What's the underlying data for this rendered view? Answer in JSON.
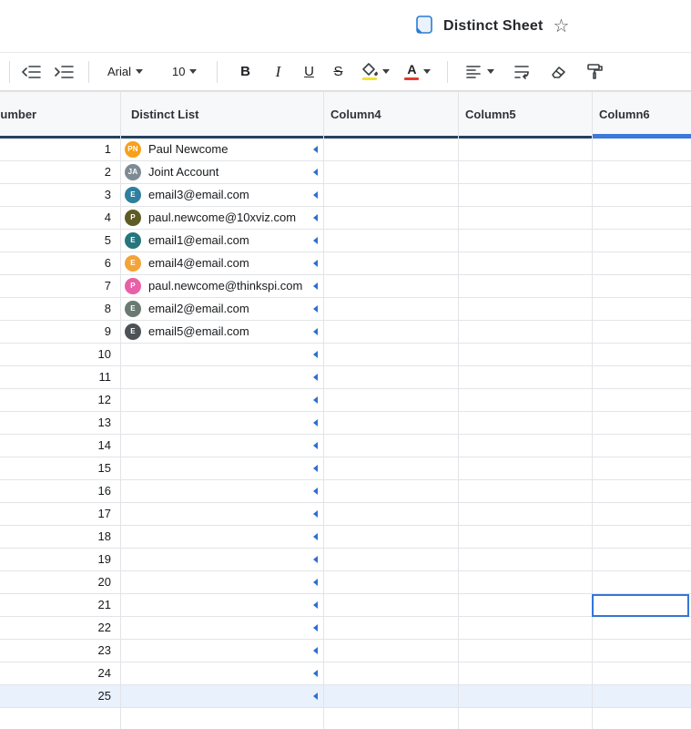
{
  "titlebar": {
    "title": "Distinct Sheet",
    "star": "☆"
  },
  "toolbar": {
    "font_name": "Arial",
    "font_size": "10",
    "bold": "B",
    "italic": "I",
    "underline": "U",
    "strikethrough": "S",
    "text_color_label": "A",
    "fill_swatch": "#f2e232",
    "text_swatch": "#e5392e"
  },
  "grid": {
    "columns": [
      {
        "label": "Number"
      },
      {
        "label": "Distinct List"
      },
      {
        "label": "Column4"
      },
      {
        "label": "Column5"
      },
      {
        "label": "Column6"
      }
    ],
    "selected_row": 25,
    "active_cell": {
      "row": 21,
      "column": "Column6"
    },
    "colors": {
      "header_underline": "#25425f",
      "selected_column_bar": "#3c79d9",
      "active_cell_border": "#3576d6",
      "row_highlight": "#e9f1fc",
      "cell_indicator": "#2e6fd0"
    },
    "rows": [
      {
        "num": "1",
        "contact": {
          "initials": "PN",
          "color": "#f7a11a",
          "name": "Paul Newcome"
        }
      },
      {
        "num": "2",
        "contact": {
          "initials": "JA",
          "color": "#7e8b94",
          "name": "Joint Account"
        }
      },
      {
        "num": "3",
        "contact": {
          "initials": "E",
          "color": "#2f7f9e",
          "name": "email3@email.com"
        }
      },
      {
        "num": "4",
        "contact": {
          "initials": "P",
          "color": "#5f5b24",
          "name": "paul.newcome@10xviz.com"
        }
      },
      {
        "num": "5",
        "contact": {
          "initials": "E",
          "color": "#27757d",
          "name": "email1@email.com"
        }
      },
      {
        "num": "6",
        "contact": {
          "initials": "E",
          "color": "#f2a43b",
          "name": "email4@email.com"
        }
      },
      {
        "num": "7",
        "contact": {
          "initials": "P",
          "color": "#e960a8",
          "name": "paul.newcome@thinkspi.com"
        }
      },
      {
        "num": "8",
        "contact": {
          "initials": "E",
          "color": "#6a7a72",
          "name": "email2@email.com"
        }
      },
      {
        "num": "9",
        "contact": {
          "initials": "E",
          "color": "#4d5257",
          "name": "email5@email.com"
        }
      },
      {
        "num": "10"
      },
      {
        "num": "11"
      },
      {
        "num": "12"
      },
      {
        "num": "13"
      },
      {
        "num": "14"
      },
      {
        "num": "15"
      },
      {
        "num": "16"
      },
      {
        "num": "17"
      },
      {
        "num": "18"
      },
      {
        "num": "19"
      },
      {
        "num": "20"
      },
      {
        "num": "21"
      },
      {
        "num": "22"
      },
      {
        "num": "23"
      },
      {
        "num": "24"
      },
      {
        "num": "25"
      }
    ]
  }
}
